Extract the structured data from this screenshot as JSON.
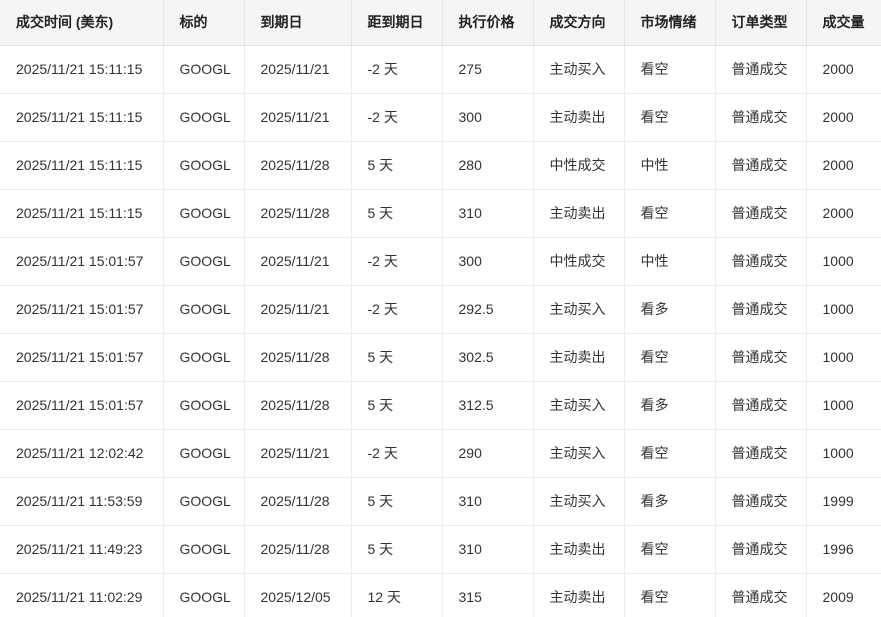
{
  "table": {
    "headers": [
      "成交时间 (美东)",
      "标的",
      "到期日",
      "距到期日",
      "执行价格",
      "成交方向",
      "市场情绪",
      "订单类型",
      "成交量"
    ],
    "rows": [
      [
        "2025/11/21 15:11:15",
        "GOOGL",
        "2025/11/21",
        "-2 天",
        "275",
        "主动买入",
        "看空",
        "普通成交",
        "2000"
      ],
      [
        "2025/11/21 15:11:15",
        "GOOGL",
        "2025/11/21",
        "-2 天",
        "300",
        "主动卖出",
        "看空",
        "普通成交",
        "2000"
      ],
      [
        "2025/11/21 15:11:15",
        "GOOGL",
        "2025/11/28",
        "5 天",
        "280",
        "中性成交",
        "中性",
        "普通成交",
        "2000"
      ],
      [
        "2025/11/21 15:11:15",
        "GOOGL",
        "2025/11/28",
        "5 天",
        "310",
        "主动卖出",
        "看空",
        "普通成交",
        "2000"
      ],
      [
        "2025/11/21 15:01:57",
        "GOOGL",
        "2025/11/21",
        "-2 天",
        "300",
        "中性成交",
        "中性",
        "普通成交",
        "1000"
      ],
      [
        "2025/11/21 15:01:57",
        "GOOGL",
        "2025/11/21",
        "-2 天",
        "292.5",
        "主动买入",
        "看多",
        "普通成交",
        "1000"
      ],
      [
        "2025/11/21 15:01:57",
        "GOOGL",
        "2025/11/28",
        "5 天",
        "302.5",
        "主动卖出",
        "看空",
        "普通成交",
        "1000"
      ],
      [
        "2025/11/21 15:01:57",
        "GOOGL",
        "2025/11/28",
        "5 天",
        "312.5",
        "主动买入",
        "看多",
        "普通成交",
        "1000"
      ],
      [
        "2025/11/21 12:02:42",
        "GOOGL",
        "2025/11/21",
        "-2 天",
        "290",
        "主动买入",
        "看空",
        "普通成交",
        "1000"
      ],
      [
        "2025/11/21 11:53:59",
        "GOOGL",
        "2025/11/28",
        "5 天",
        "310",
        "主动买入",
        "看多",
        "普通成交",
        "1999"
      ],
      [
        "2025/11/21 11:49:23",
        "GOOGL",
        "2025/11/28",
        "5 天",
        "310",
        "主动卖出",
        "看空",
        "普通成交",
        "1996"
      ],
      [
        "2025/11/21 11:02:29",
        "GOOGL",
        "2025/12/05",
        "12 天",
        "315",
        "主动卖出",
        "看空",
        "普通成交",
        "2009"
      ]
    ]
  }
}
